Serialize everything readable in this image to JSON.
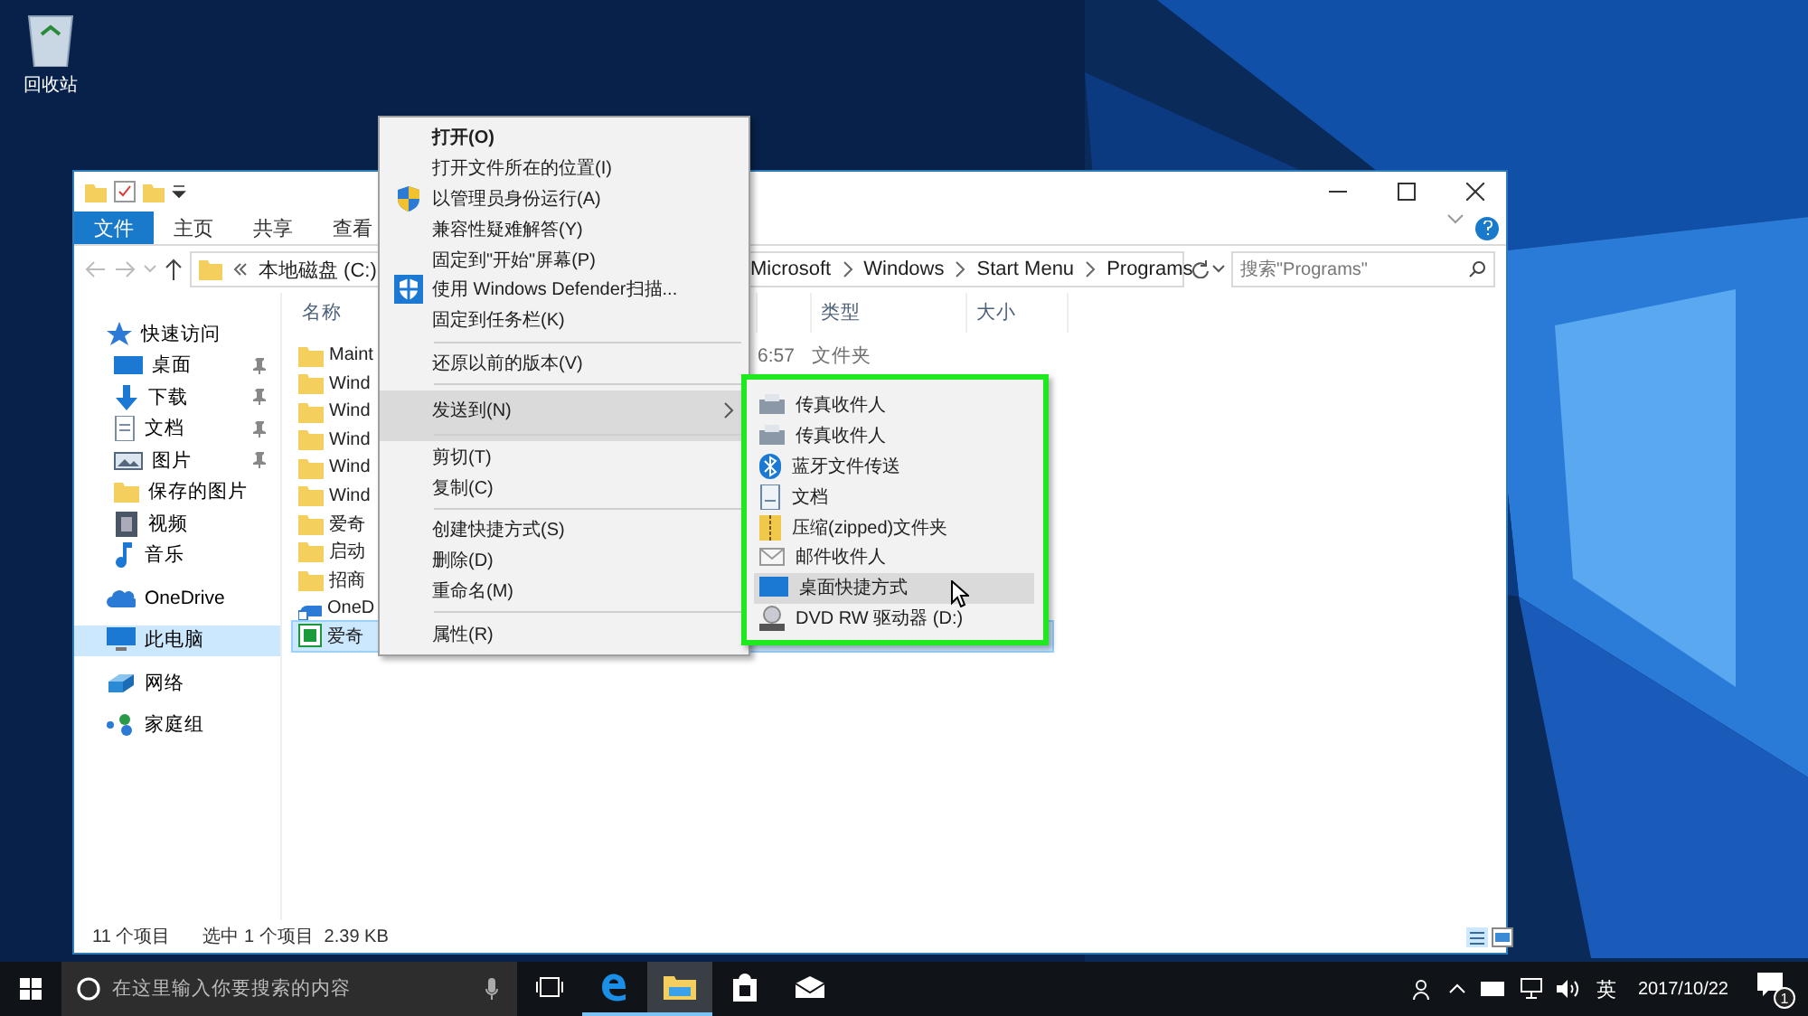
{
  "desktop": {
    "icons": [
      {
        "label": "回收站"
      }
    ]
  },
  "explorer": {
    "ribbon_tabs": [
      {
        "label": "文件",
        "selected": true
      },
      {
        "label": "主页",
        "selected": false
      },
      {
        "label": "共享",
        "selected": false
      },
      {
        "label": "查看",
        "selected": false
      }
    ],
    "address": {
      "left_segments": [
        "本地磁盘 (C:)"
      ],
      "right_segments": [
        "Microsoft",
        "Windows",
        "Start Menu",
        "Programs"
      ]
    },
    "search": {
      "placeholder": "搜索\"Programs\""
    },
    "nav": [
      {
        "label": "快速访问",
        "selected": false,
        "pinned": false,
        "children": [
          {
            "label": "桌面",
            "selected": false,
            "pinned": true
          },
          {
            "label": "下载",
            "selected": false,
            "pinned": true
          },
          {
            "label": "文档",
            "selected": false,
            "pinned": true
          },
          {
            "label": "图片",
            "selected": false,
            "pinned": true
          },
          {
            "label": "保存的图片",
            "selected": false,
            "pinned": false
          },
          {
            "label": "视频",
            "selected": false,
            "pinned": false
          },
          {
            "label": "音乐",
            "selected": false,
            "pinned": false
          }
        ]
      },
      {
        "label": "OneDrive",
        "selected": false,
        "pinned": false
      },
      {
        "label": "此电脑",
        "selected": true,
        "pinned": false
      },
      {
        "label": "网络",
        "selected": false,
        "pinned": false
      },
      {
        "label": "家庭组",
        "selected": false,
        "pinned": false
      }
    ],
    "columns": [
      "名称",
      "类型",
      "大小"
    ],
    "rows": [
      {
        "name": "Maint",
        "column_2": "6:57",
        "type": "文件夹",
        "selected": false
      },
      {
        "name": "Wind",
        "selected": false
      },
      {
        "name": "Wind",
        "selected": false
      },
      {
        "name": "Wind",
        "selected": false
      },
      {
        "name": "Wind",
        "selected": false
      },
      {
        "name": "Wind",
        "selected": false
      },
      {
        "name": "爱奇",
        "selected": false
      },
      {
        "name": "启动",
        "selected": false
      },
      {
        "name": "招商",
        "selected": false
      },
      {
        "name": "OneD",
        "selected": false
      },
      {
        "name": "爱奇",
        "selected": true
      }
    ],
    "status_bar": {
      "count": "11 个项目",
      "selection": "选中 1 个项目",
      "size": "2.39 KB"
    }
  },
  "context_menu": {
    "items": [
      {
        "label": "打开(O)",
        "default": true,
        "highlighted": false,
        "submenu": false,
        "separator_after": false
      },
      {
        "label": "打开文件所在的位置(I)",
        "default": false,
        "highlighted": false,
        "submenu": false,
        "separator_after": false
      },
      {
        "label": "以管理员身份运行(A)",
        "default": false,
        "highlighted": false,
        "submenu": false,
        "separator_after": false
      },
      {
        "label": "兼容性疑难解答(Y)",
        "default": false,
        "highlighted": false,
        "submenu": false,
        "separator_after": false
      },
      {
        "label": "固定到\"开始\"屏幕(P)",
        "default": false,
        "highlighted": false,
        "submenu": false,
        "separator_after": false
      },
      {
        "label": "使用 Windows Defender扫描...",
        "default": false,
        "highlighted": false,
        "submenu": false,
        "separator_after": false
      },
      {
        "label": "固定到任务栏(K)",
        "default": false,
        "highlighted": false,
        "submenu": false,
        "separator_after": true
      },
      {
        "label": "还原以前的版本(V)",
        "default": false,
        "highlighted": false,
        "submenu": false,
        "separator_after": true
      },
      {
        "label": "发送到(N)",
        "default": false,
        "highlighted": true,
        "submenu": true,
        "separator_after": true
      },
      {
        "label": "剪切(T)",
        "default": false,
        "highlighted": false,
        "submenu": false,
        "separator_after": false
      },
      {
        "label": "复制(C)",
        "default": false,
        "highlighted": false,
        "submenu": false,
        "separator_after": true
      },
      {
        "label": "创建快捷方式(S)",
        "default": false,
        "highlighted": false,
        "submenu": false,
        "separator_after": false
      },
      {
        "label": "删除(D)",
        "default": false,
        "highlighted": false,
        "submenu": false,
        "separator_after": false
      },
      {
        "label": "重命名(M)",
        "default": false,
        "highlighted": false,
        "submenu": false,
        "separator_after": true
      },
      {
        "label": "属性(R)",
        "default": false,
        "highlighted": false,
        "submenu": false,
        "separator_after": false
      }
    ]
  },
  "send_to_menu": {
    "outlined": true,
    "items": [
      {
        "label": "传真收件人",
        "highlighted": false
      },
      {
        "label": "传真收件人",
        "highlighted": false
      },
      {
        "label": "蓝牙文件传送",
        "highlighted": false
      },
      {
        "label": "文档",
        "highlighted": false
      },
      {
        "label": "压缩(zipped)文件夹",
        "highlighted": false
      },
      {
        "label": "邮件收件人",
        "highlighted": false
      },
      {
        "label": "桌面快捷方式",
        "highlighted": true
      },
      {
        "label": "DVD RW 驱动器 (D:)",
        "highlighted": false
      }
    ]
  },
  "taskbar": {
    "search": {
      "placeholder": "在这里输入你要搜索的内容"
    },
    "apps": [
      {
        "running": false,
        "active": false
      },
      {
        "running": true,
        "active": false
      },
      {
        "running": true,
        "active": true
      },
      {
        "running": false,
        "active": false
      },
      {
        "running": false,
        "active": false
      }
    ],
    "tray": {
      "ime": "英",
      "date": "2017/10/22",
      "notifications": "1"
    }
  }
}
